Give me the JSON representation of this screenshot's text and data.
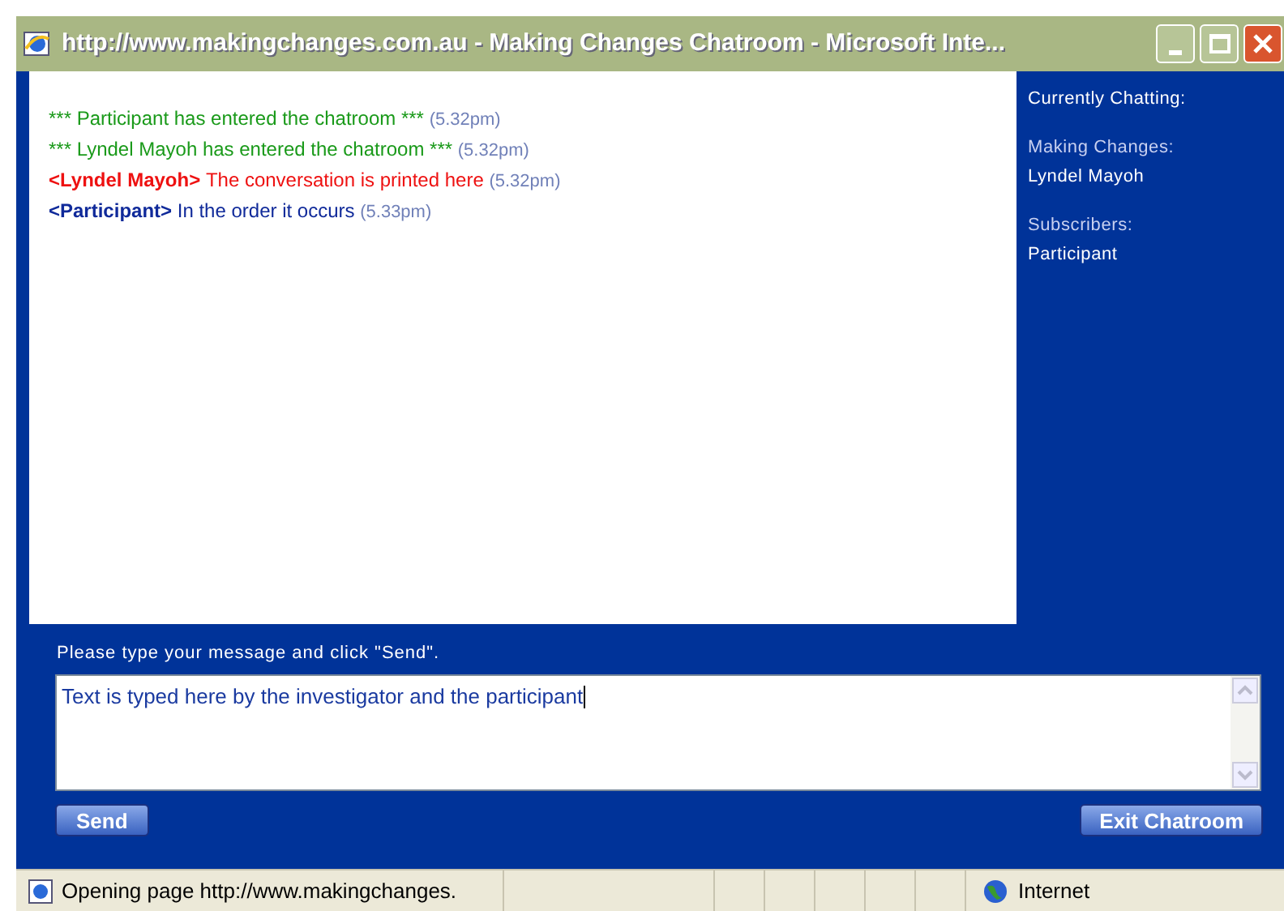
{
  "window": {
    "title": "http://www.makingchanges.com.au - Making Changes Chatroom - Microsoft Inte..."
  },
  "messages": [
    {
      "kind": "system",
      "color": "#1a9a1a",
      "text": "*** Participant has entered the chatroom ***",
      "time": "(5.32pm)"
    },
    {
      "kind": "system",
      "color": "#1a9a1a",
      "text": "*** Lyndel Mayoh has entered the chatroom ***",
      "time": "(5.32pm)"
    },
    {
      "kind": "message",
      "color": "#ee1111",
      "sender": "<Lyndel Mayoh>",
      "text": "The conversation is printed here",
      "time": "(5.32pm)"
    },
    {
      "kind": "message",
      "color": "#102a9a",
      "sender": "<Participant>",
      "text": "In the order it occurs",
      "time": "(5.33pm)"
    }
  ],
  "sidebar": {
    "heading": "Currently Chatting:",
    "groups": [
      {
        "label": "Making Changes:",
        "members": [
          "Lyndel Mayoh"
        ]
      },
      {
        "label": "Subscribers:",
        "members": [
          "Participant"
        ]
      }
    ]
  },
  "compose": {
    "prompt": "Please type your message and click \"Send\".",
    "value": "Text is typed here by the investigator and the participant"
  },
  "buttons": {
    "send": "Send",
    "exit": "Exit Chatroom"
  },
  "status_bar": {
    "text": "Opening page http://www.makingchanges.",
    "zone": "Internet"
  }
}
